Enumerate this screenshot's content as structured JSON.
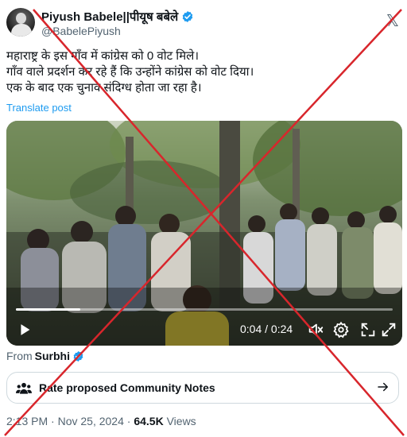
{
  "user": {
    "display_name": "Piyush Babele||पीयूष बबेले",
    "handle": "@BabelePiyush"
  },
  "tweet": {
    "lines": [
      "महाराष्ट्र के इस गाँव में कांग्रेस को 0 वोट मिले।",
      "गाँव वाले प्रदर्शन कर रहे हैं कि उन्होंने कांग्रेस को वोट दिया।",
      "एक के बाद एक चुनाव संदिग्ध होता जा रहा है।"
    ],
    "translate_label": "Translate post"
  },
  "video": {
    "elapsed": "0:04",
    "duration": "0:24",
    "time_separator": "/",
    "progress_fraction": 0.17
  },
  "source": {
    "prefix": "From",
    "name": "Surbhi"
  },
  "community_notes": {
    "label": "Rate proposed Community Notes"
  },
  "meta": {
    "time": "2:13 PM",
    "date": "Nov 25, 2024",
    "separator": "·",
    "views_count": "64.5K",
    "views_label": "Views"
  },
  "colors": {
    "accent": "#1d9bf0",
    "cross": "#d8262c",
    "text_secondary": "#536471"
  },
  "icons": [
    "verified-badge-icon",
    "play-icon",
    "mute-icon",
    "settings-icon",
    "pip-icon",
    "fullscreen-icon",
    "community-notes-icon",
    "chevron-right-icon"
  ]
}
